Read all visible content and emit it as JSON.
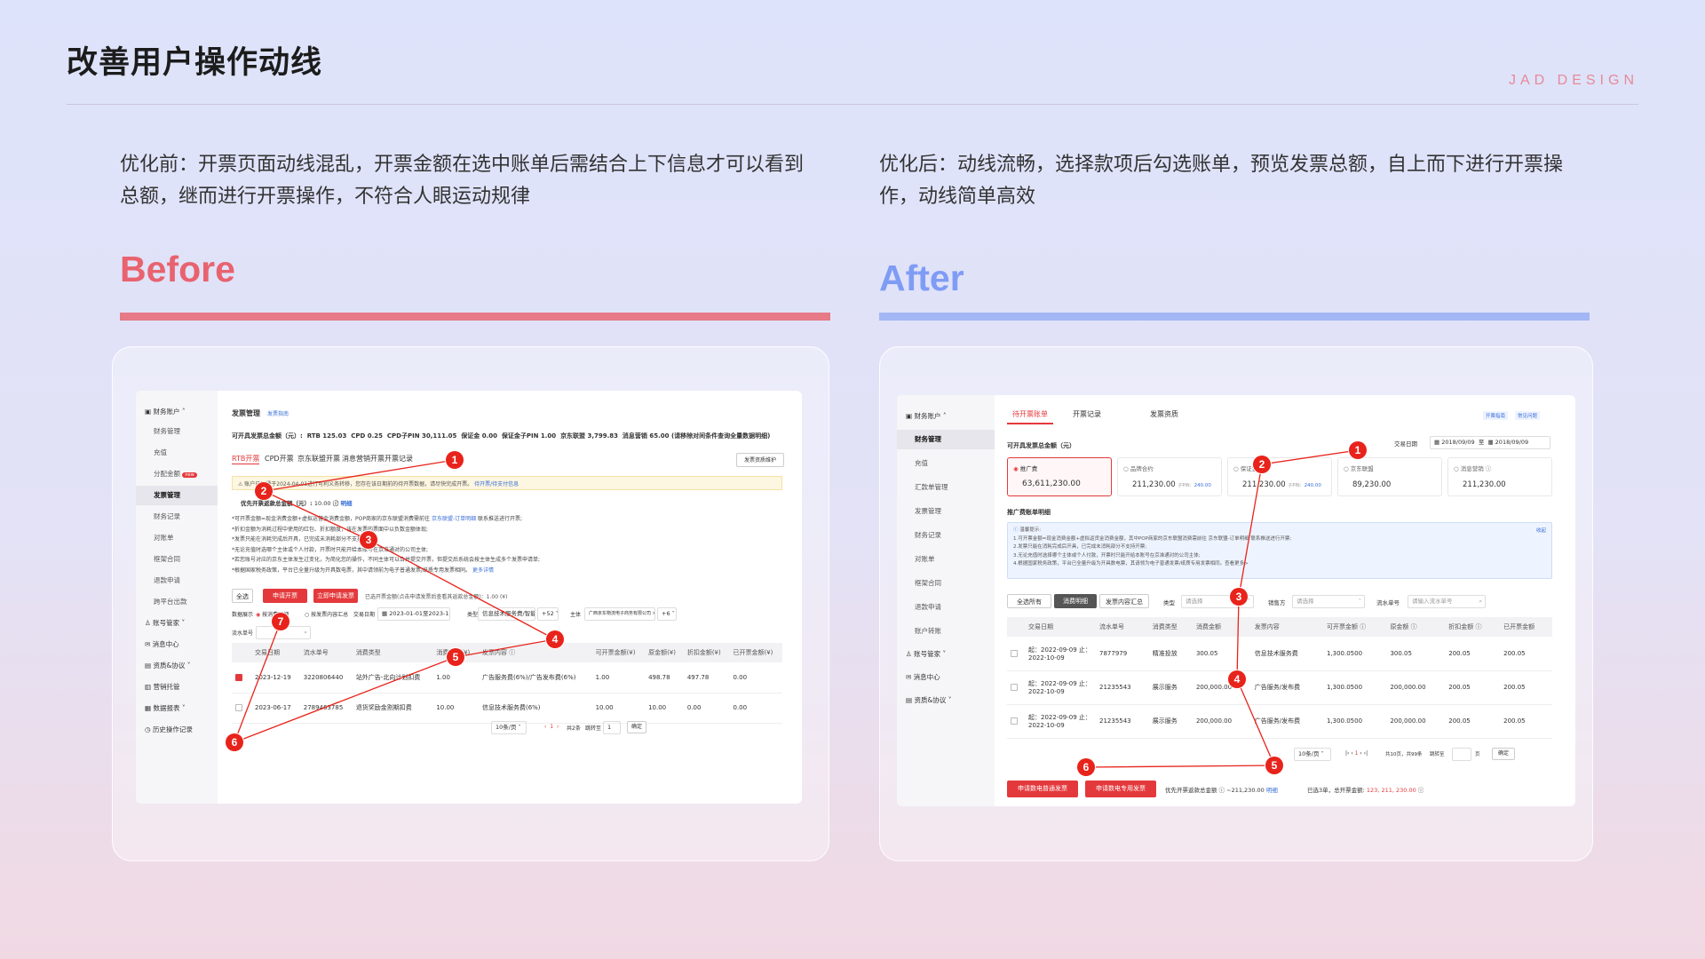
{
  "slide": {
    "title": "改善用户操作动线",
    "brand": "JAD DESIGN",
    "colors": {
      "before": "#e8636f",
      "after": "#7f9cf5",
      "badge": "#e8231b",
      "accent": "#e4393c"
    }
  },
  "before": {
    "desc": "优化前：开票页面动线混乱，开票金额在选中账单后需结合上下信息才可以看到总额，继而进行开票操作，不符合人眼运动规律",
    "heading": "Before",
    "app": {
      "sidebar": {
        "group": "财务账户",
        "items": [
          "财务管理",
          "充值",
          "分配金额",
          "发票管理",
          "财务记录",
          "对账单",
          "框架合同",
          "退款申请",
          "跨平台出款"
        ],
        "active": "发票管理",
        "new_badge": "new",
        "groups2": [
          "账号管家",
          "消息中心",
          "资质&协议",
          "营销托管",
          "数据报表",
          "历史操作记录"
        ]
      },
      "header": {
        "title": "发票管理",
        "link": "发票指南"
      },
      "summary": {
        "label": "可开具发票总金额（元）:",
        "items": [
          "RTB 125.03",
          "CPD 0.25",
          "CPD子PIN 30,111.05",
          "保证金 0.00",
          "保证金子PIN 1.00",
          "京东联盟 3,799.83",
          "消息营销 65.00"
        ],
        "note": "(请移除对间条件查询全量数据明细)"
      },
      "tabs": [
        "RTB开票",
        "CPD开票",
        "京东联盟开票",
        "消息营销开票",
        "开票记录"
      ],
      "right_button": "发票资质维护",
      "notice": {
        "text": "账户已开通于2024-04-01进行可利义务转移，您存在该日期前的待开票数据，请尽快完成开票。",
        "link": "待开票/待支付信息"
      },
      "priority": {
        "label": "优先开票返款总金额（元）:",
        "value": "10.00",
        "link": "明细"
      },
      "rules": [
        "*可开票金额=现金消费金额+虚拟运营金消费金额，POP商家的京东联盟消费需前往",
        "*折扣金额为消耗过程中使用的红包、折扣额度，该在发票的票面中以负数金额体现;",
        "*发票只能在消耗完成后开具，已完成未消耗部分不支持开票;",
        "*无论充值时选哪个主体或个人付款，开票时只能开给本账号在京准通对的公司主体;",
        "*若您账号对应的京东主体发生过变化，为简化您的操作，不同主体可以合并提交开票，但提交后系统会按主体生成多个发票申请单;",
        "*根据国家税务政策，平台已全量升级为开具数电票，其中请领前为电子普通发票/纸质专用发票相同。"
      ],
      "rules_link1": "京东联盟-订单明细",
      "rules_tail1": "联系推送进行开票;",
      "rules_link2": "更多详情",
      "actions": {
        "select_all": "全选",
        "btn1": "申请开票",
        "btn2": "立即申请发票",
        "selected": "已选开票金额(点击申请发票后查看其返款总金额)：1.00 (¥)"
      },
      "filters": {
        "label": "数据展示",
        "opt1": "按消费明细",
        "opt2": "按发票内容汇总",
        "date_label": "交易日期",
        "date": "2023-01-01至2023-12-31",
        "type_label": "类型",
        "type_value": "信息技术服务费/智能...",
        "type_more": "+52",
        "subject_label": "主体",
        "subject": "广西京东物流电子商务有限公司",
        "subject_more": "+6",
        "serial_label": "流水单号"
      },
      "table": {
        "headers": [
          "交易日期",
          "流水单号",
          "消费类型",
          "消费金额(¥)",
          "发票内容 ⓘ",
          "可开票金额(¥)",
          "原金额(¥)",
          "折扣金额(¥)",
          "已开票金额(¥)"
        ],
        "rows": [
          [
            "2023-12-19",
            "3220806440",
            "站外广告-北向计划扣费",
            "1.00",
            "广告服务费(6%)/广告发布费(6%)",
            "1.00",
            "498.78",
            "497.78",
            "0.00"
          ],
          [
            "2023-06-17",
            "2789463785",
            "退货奖励金割期扣费",
            "10.00",
            "信息技术服务费(6%)",
            "10.00",
            "10.00",
            "0.00",
            "0.00"
          ]
        ]
      },
      "pagination": {
        "size": "10条/页",
        "current": "1",
        "total": "共2条",
        "jump": "跳转至",
        "page": "1",
        "ok": "确定"
      }
    },
    "badges": [
      "1",
      "2",
      "3",
      "4",
      "5",
      "6",
      "7"
    ]
  },
  "after": {
    "desc": "优化后：动线流畅，选择款项后勾选账单，预览发票总额，自上而下进行开票操作，动线简单高效",
    "heading": "After",
    "app": {
      "sidebar": {
        "group": "财务账户",
        "items": [
          "财务管理",
          "充值",
          "汇款单管理",
          "发票管理",
          "财务记录",
          "对账单",
          "框架合同",
          "退款申请",
          "账户转账"
        ],
        "active": "财务管理",
        "groups2": [
          "账号管家",
          "消息中心",
          "资质&协议"
        ]
      },
      "tabs": [
        "待开票账单",
        "开票记录",
        "发票资质"
      ],
      "top_links": [
        "开票指南",
        "常见问题"
      ],
      "summary_label": "可开具发票总金额（元）",
      "date_label": "交易日期",
      "date_from": "2018/09/09",
      "date_sep": "至",
      "date_to": "2018/09/09",
      "cards": [
        {
          "name": "推广费",
          "value": "63,611,230.00"
        },
        {
          "name": "品牌合约",
          "value": "211,230.00",
          "sub": "子PIN：",
          "sub_val": "240.00"
        },
        {
          "name": "保证金",
          "value": "211,230.00",
          "sub": "子PIN：",
          "sub_val": "240.00"
        },
        {
          "name": "京东联盟",
          "value": "89,230.00"
        },
        {
          "name": "消息营销 ⓘ",
          "value": "211,230.00"
        }
      ],
      "detail_title": "推广费账单明细",
      "info": {
        "title": "温馨提示:",
        "lines": [
          "1.可开票金额=现金消费金额+虚拟返货金消费金额，其中POP商家的京东联盟消费需前往 京东联盟-订单明细 联系推送进行开票;",
          "2.发票只能在消耗完成后开具，已完成未消耗部分不支持开票;",
          "3.无论充值时选择哪个主体或个人付款，开票时只能开给本账号在京准通对的公司主体;",
          "4.根据国家税务政策，平台已全量升级为开具数电票，其请领为电子普通发票/纸质专用发票相同。查看更多>"
        ],
        "collapse": "收起"
      },
      "filters": {
        "btns": [
          "全选所有",
          "消费明细",
          "发票内容汇总"
        ],
        "type_label": "类型",
        "type_ph": "请选择",
        "sales_label": "销售方",
        "sales_ph": "请选择",
        "serial_label": "流水单号",
        "serial_ph": "请输入流水单号"
      },
      "table": {
        "headers": [
          "交易日期",
          "流水单号",
          "消费类型",
          "消费金额",
          "发票内容",
          "可开票金额 ⓘ",
          "原金额 ⓘ",
          "折扣金额 ⓘ",
          "已开票金额"
        ],
        "rows": [
          [
            "起：2022-09-09 止：2022-10-09",
            "7877979",
            "精准投放",
            "300.05",
            "信息技术服务费",
            "1,300.0500",
            "300.05",
            "200.05",
            "200.05"
          ],
          [
            "起：2022-09-09 止：2022-10-09",
            "21235543",
            "展示服务",
            "200,000.00",
            "广告服务/发布费",
            "1,300.0500",
            "200,000.00",
            "200.05",
            "200.05"
          ],
          [
            "起：2022-09-09 止：2022-10-09",
            "21235543",
            "展示服务",
            "200,000.00",
            "广告服务/发布费",
            "1,300.0500",
            "200,000.00",
            "200.05",
            "200.05"
          ]
        ]
      },
      "pagination": {
        "size": "10条/页",
        "current": "1",
        "total": "共10页，共99条",
        "jump": "跳转至",
        "unit": "页",
        "ok": "确定"
      },
      "bottom": {
        "btn1": "申请数电普通发票",
        "btn2": "申请数电专用发票",
        "priority": "优先开票返款总金额 ⓘ ~211,230.00",
        "priority_link": "明细",
        "selected": "已选3单，总开票金额:",
        "total": "123, 211, 230.00"
      }
    },
    "badges": [
      "1",
      "2",
      "3",
      "4",
      "5",
      "6"
    ]
  }
}
